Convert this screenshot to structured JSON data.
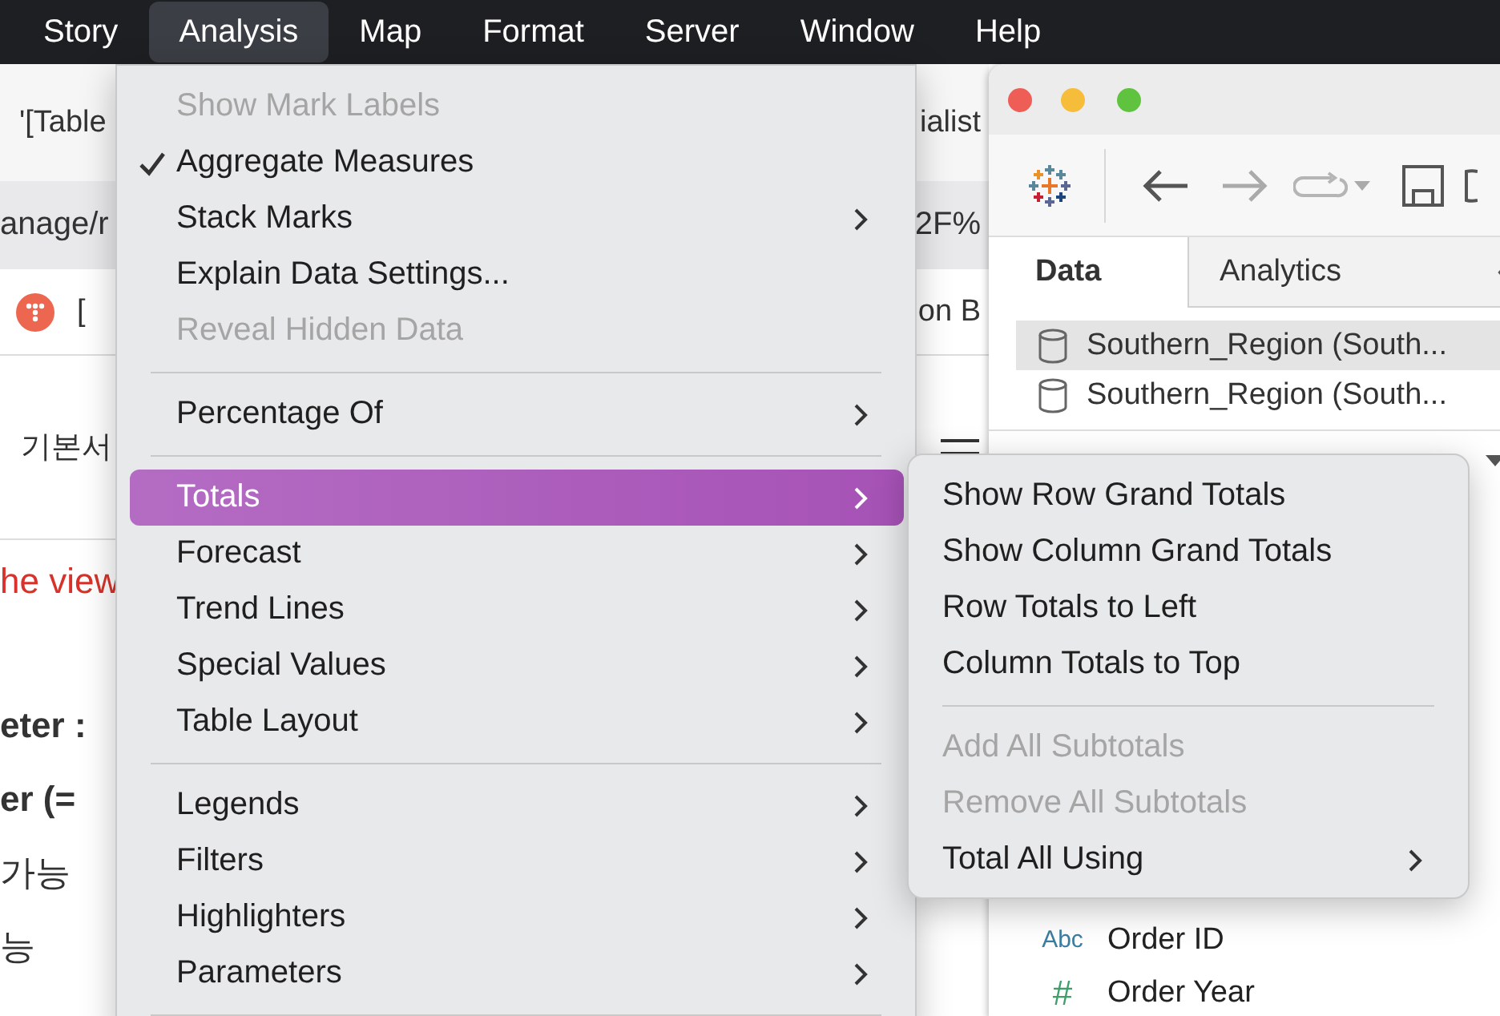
{
  "menu_bar": [
    {
      "label": "Story",
      "selected": false
    },
    {
      "label": "Analysis",
      "selected": true
    },
    {
      "label": "Map",
      "selected": false
    },
    {
      "label": "Format",
      "selected": false
    },
    {
      "label": "Server",
      "selected": false
    },
    {
      "label": "Window",
      "selected": false
    },
    {
      "label": "Help",
      "selected": false
    }
  ],
  "background_page": {
    "tab_title": "'[Table",
    "tab_title_end": "ialist",
    "address": "anage/r",
    "address_end": "2F%",
    "bookmark": "[",
    "bookmark_end": "on B",
    "heading": "기본서",
    "lines": [
      {
        "text": "he view",
        "kind": "notice"
      },
      {
        "text": "eter :",
        "kind": "bold"
      },
      {
        "text": "er (=",
        "kind": "bold"
      },
      {
        "text": "가능",
        "kind": "plain"
      },
      {
        "text": "능",
        "kind": "plain"
      }
    ]
  },
  "tableau_window": {
    "tabs": [
      {
        "label": "Data",
        "selected": true
      },
      {
        "label": "Analytics",
        "selected": false
      }
    ],
    "data_sources": [
      {
        "name": "Southern_Region (South...",
        "selected": true
      },
      {
        "name": "Southern_Region (South...",
        "selected": false
      }
    ],
    "fields": [
      {
        "type_label": "Abc",
        "name": "Order ID",
        "kind": "dimension"
      },
      {
        "type_label": "#",
        "name": "Order Year",
        "kind": "measure"
      }
    ]
  },
  "analysis_menu": [
    {
      "kind": "item",
      "label": "Show Mark Labels",
      "checked": false,
      "disabled": true,
      "submenu": false,
      "selected": false
    },
    {
      "kind": "item",
      "label": "Aggregate Measures",
      "checked": true,
      "disabled": false,
      "submenu": false,
      "selected": false
    },
    {
      "kind": "item",
      "label": "Stack Marks",
      "checked": false,
      "disabled": false,
      "submenu": true,
      "selected": false
    },
    {
      "kind": "item",
      "label": "Explain Data Settings...",
      "checked": false,
      "disabled": false,
      "submenu": false,
      "selected": false
    },
    {
      "kind": "item",
      "label": "Reveal Hidden Data",
      "checked": false,
      "disabled": true,
      "submenu": false,
      "selected": false
    },
    {
      "kind": "separator"
    },
    {
      "kind": "item",
      "label": "Percentage Of",
      "checked": false,
      "disabled": false,
      "submenu": true,
      "selected": false
    },
    {
      "kind": "separator"
    },
    {
      "kind": "item",
      "label": "Totals",
      "checked": false,
      "disabled": false,
      "submenu": true,
      "selected": true
    },
    {
      "kind": "item",
      "label": "Forecast",
      "checked": false,
      "disabled": false,
      "submenu": true,
      "selected": false
    },
    {
      "kind": "item",
      "label": "Trend Lines",
      "checked": false,
      "disabled": false,
      "submenu": true,
      "selected": false
    },
    {
      "kind": "item",
      "label": "Special Values",
      "checked": false,
      "disabled": false,
      "submenu": true,
      "selected": false
    },
    {
      "kind": "item",
      "label": "Table Layout",
      "checked": false,
      "disabled": false,
      "submenu": true,
      "selected": false
    },
    {
      "kind": "separator"
    },
    {
      "kind": "item",
      "label": "Legends",
      "checked": false,
      "disabled": false,
      "submenu": true,
      "selected": false
    },
    {
      "kind": "item",
      "label": "Filters",
      "checked": false,
      "disabled": false,
      "submenu": true,
      "selected": false
    },
    {
      "kind": "item",
      "label": "Highlighters",
      "checked": false,
      "disabled": false,
      "submenu": true,
      "selected": false
    },
    {
      "kind": "item",
      "label": "Parameters",
      "checked": false,
      "disabled": false,
      "submenu": true,
      "selected": false
    },
    {
      "kind": "separator"
    }
  ],
  "totals_submenu": [
    {
      "kind": "item",
      "label": "Show Row Grand Totals",
      "checked": false,
      "disabled": false,
      "submenu": false,
      "selected": false
    },
    {
      "kind": "item",
      "label": "Show Column Grand Totals",
      "checked": false,
      "disabled": false,
      "submenu": false,
      "selected": false
    },
    {
      "kind": "item",
      "label": "Row Totals to Left",
      "checked": false,
      "disabled": false,
      "submenu": false,
      "selected": false
    },
    {
      "kind": "item",
      "label": "Column Totals to Top",
      "checked": false,
      "disabled": false,
      "submenu": false,
      "selected": false
    },
    {
      "kind": "separator"
    },
    {
      "kind": "item",
      "label": "Add All Subtotals",
      "checked": false,
      "disabled": true,
      "submenu": false,
      "selected": false
    },
    {
      "kind": "item",
      "label": "Remove All Subtotals",
      "checked": false,
      "disabled": true,
      "submenu": false,
      "selected": false
    },
    {
      "kind": "item",
      "label": "Total All Using",
      "checked": false,
      "disabled": false,
      "submenu": true,
      "selected": false
    }
  ]
}
